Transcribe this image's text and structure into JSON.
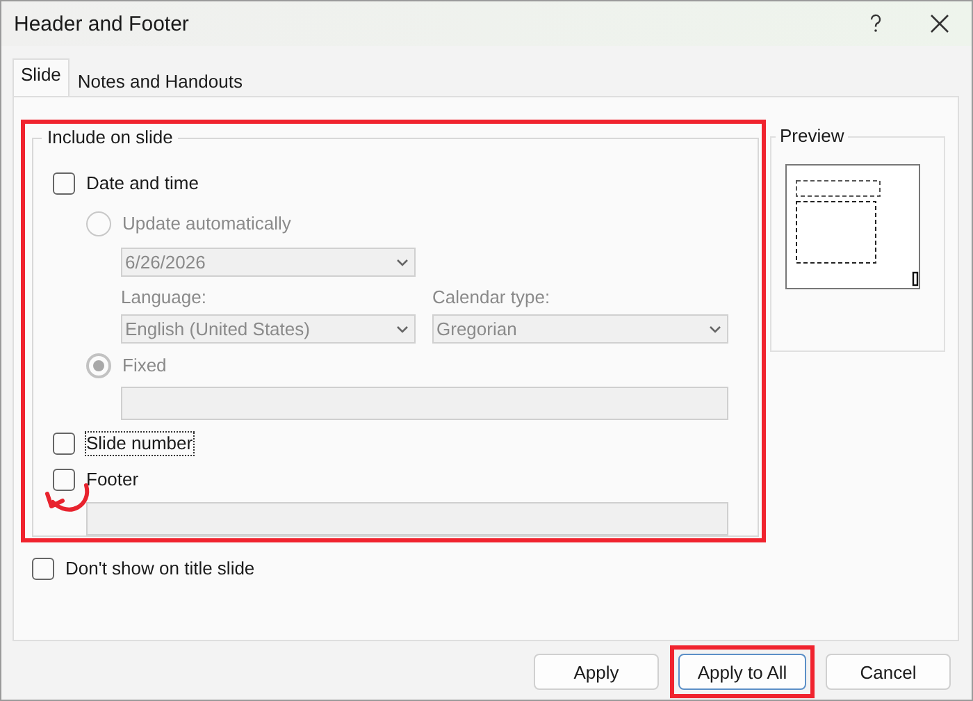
{
  "window": {
    "title": "Header and Footer"
  },
  "tabs": [
    {
      "label": "Slide",
      "selected": true
    },
    {
      "label": "Notes and Handouts",
      "selected": false
    }
  ],
  "include_on_slide": {
    "title": "Include on slide",
    "highlighted": true,
    "date_and_time": {
      "label": "Date and time",
      "checked": false
    },
    "update_automatically": {
      "label": "Update automatically",
      "selected": false,
      "disabled": true
    },
    "date": {
      "value": "6/26/2026",
      "disabled": true
    },
    "language": {
      "label": "Language:",
      "value": "English (United States)",
      "disabled": true
    },
    "calendar_type": {
      "label": "Calendar type:",
      "value": "Gregorian",
      "disabled": true
    },
    "fixed": {
      "label": "Fixed",
      "selected": true,
      "disabled": true
    },
    "fixed_field": {
      "disabled": true
    },
    "slide_number": {
      "label": "Slide number",
      "checked": false,
      "focused": true
    },
    "footer": {
      "label": "Footer",
      "checked": false
    },
    "footer_field": {
      "disabled": true
    }
  },
  "preview": {
    "title": "Preview"
  },
  "dont_show_on_title_slide": {
    "label": "Don't show on title slide",
    "checked": false
  },
  "buttons": [
    {
      "label": "Apply",
      "highlighted": false,
      "default": false
    },
    {
      "label": "Apply to All",
      "highlighted": true,
      "default": true
    },
    {
      "label": "Cancel",
      "highlighted": false,
      "default": false
    }
  ]
}
